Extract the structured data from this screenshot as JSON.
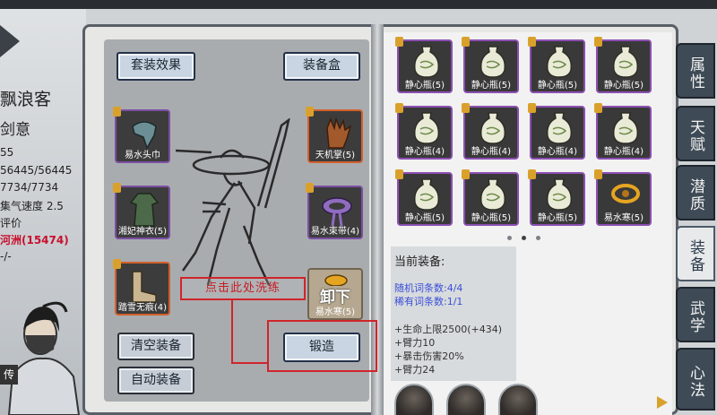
{
  "character": {
    "name": "飘浪客",
    "title": "剑意",
    "stats": [
      "55",
      "56445/56445",
      "7734/7734",
      "集气速度 2.5",
      "评价",
      "河洲(15474)",
      "-/-"
    ],
    "pass_tag": "传"
  },
  "left_page": {
    "set_effect_button": "套装效果",
    "equip_box_button": "装备盒",
    "clear_button": "清空装备",
    "auto_button": "自动装备",
    "forge_button": "锻造",
    "unequip_label": "卸下",
    "callout_text": "点击此处洗练"
  },
  "equipped_slots": [
    {
      "label": "易水头巾",
      "icon": "headband-icon",
      "side": "left",
      "border": "#7b4fa3"
    },
    {
      "label": "湘妃神衣(5)",
      "icon": "robe-icon",
      "side": "left",
      "border": "#7b4fa3"
    },
    {
      "label": "踏雪无痕(4)",
      "icon": "boots-icon",
      "side": "left",
      "border": "#d1602d"
    },
    {
      "label": "天机掌(5)",
      "icon": "gloves-icon",
      "side": "right",
      "border": "#d1602d"
    },
    {
      "label": "易水束带(4)",
      "icon": "belt-icon",
      "side": "right",
      "border": "#7b4fa3"
    },
    {
      "label": "易水寒(5)",
      "icon": "amulet-icon",
      "side": "right",
      "border": "#7b4fa3"
    }
  ],
  "bag": {
    "items": [
      {
        "label": "静心瓶(5)",
        "icon": "bottle-icon"
      },
      {
        "label": "静心瓶(5)",
        "icon": "bottle-icon"
      },
      {
        "label": "静心瓶(5)",
        "icon": "bottle-icon"
      },
      {
        "label": "静心瓶(5)",
        "icon": "bottle-icon"
      },
      {
        "label": "静心瓶(4)",
        "icon": "bottle-icon"
      },
      {
        "label": "静心瓶(4)",
        "icon": "bottle-icon"
      },
      {
        "label": "静心瓶(4)",
        "icon": "bottle-icon"
      },
      {
        "label": "静心瓶(4)",
        "icon": "bottle-icon"
      },
      {
        "label": "静心瓶(5)",
        "icon": "bottle-icon"
      },
      {
        "label": "静心瓶(5)",
        "icon": "bottle-icon"
      },
      {
        "label": "静心瓶(5)",
        "icon": "bottle-icon"
      },
      {
        "label": "易水寒(5)",
        "icon": "amulet-icon"
      }
    ]
  },
  "current_equipment": {
    "title": "当前装备:",
    "lines": [
      {
        "text": "随机词条数:4/4",
        "color": "#3a4fd8"
      },
      {
        "text": "稀有词条数:1/1",
        "color": "#3a4fd8"
      },
      {
        "text": "+生命上限2500(+434)",
        "color": "#333333"
      },
      {
        "text": "+臂力10",
        "color": "#333333"
      },
      {
        "text": "+暴击伤害20%",
        "color": "#333333"
      },
      {
        "text": "+臂力24",
        "color": "#333333"
      }
    ]
  },
  "side_tabs": [
    {
      "label": "属性",
      "active": false
    },
    {
      "label": "天赋",
      "active": false
    },
    {
      "label": "潜质",
      "active": false
    },
    {
      "label": "装备",
      "active": true
    },
    {
      "label": "武学",
      "active": false
    },
    {
      "label": "心法",
      "active": false
    }
  ]
}
